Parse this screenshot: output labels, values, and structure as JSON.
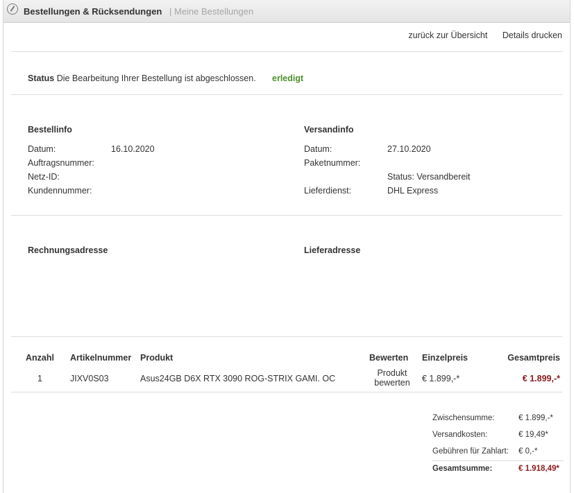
{
  "header": {
    "title": "Bestellungen & Rücksendungen",
    "breadcrumb": "| Meine Bestellungen"
  },
  "toplinks": {
    "back": "zurück zur Übersicht",
    "print": "Details drucken"
  },
  "status": {
    "label": "Status",
    "text": "Die Bearbeitung Ihrer Bestellung ist abgeschlossen.",
    "badge": "erledigt"
  },
  "bestellinfo": {
    "heading": "Bestellinfo",
    "datum_label": "Datum:",
    "datum_value": "16.10.2020",
    "auftrag_label": "Auftragsnummer:",
    "netz_label": "Netz-ID:",
    "kunden_label": "Kundennummer:"
  },
  "versandinfo": {
    "heading": "Versandinfo",
    "datum_label": "Datum:",
    "datum_value": "27.10.2020",
    "paket_label": "Paketnummer:",
    "status_value": "Status: Versandbereit",
    "liefer_label": "Lieferdienst:",
    "liefer_value": "DHL Express"
  },
  "addresses": {
    "billing": "Rechnungsadresse",
    "shipping": "Lieferadresse"
  },
  "table": {
    "columns": [
      "Anzahl",
      "Artikelnummer",
      "Produkt",
      "Bewerten",
      "Einzelpreis",
      "Gesamtpreis"
    ],
    "rows": [
      {
        "qty": "1",
        "article": "JIXV0S03",
        "product": "Asus24GB D6X RTX 3090 ROG-STRIX GAMI. OC",
        "rate_line1": "Produkt",
        "rate_line2": "bewerten",
        "unit_price": "€ 1.899,-*",
        "total_price": "€ 1.899,-*"
      }
    ]
  },
  "totals": {
    "subtotal_label": "Zwischensumme:",
    "subtotal_value": "€ 1.899,-*",
    "shipping_label": "Versandkosten:",
    "shipping_value": "€ 19,49*",
    "fee_label": "Gebühren für Zahlart:",
    "fee_value": "€ 0,-*",
    "grand_label": "Gesamtsumme:",
    "grand_value": "€ 1.918,49*"
  },
  "colors": {
    "done_green": "#4f8f2c",
    "price_red": "#8b1a1a"
  }
}
